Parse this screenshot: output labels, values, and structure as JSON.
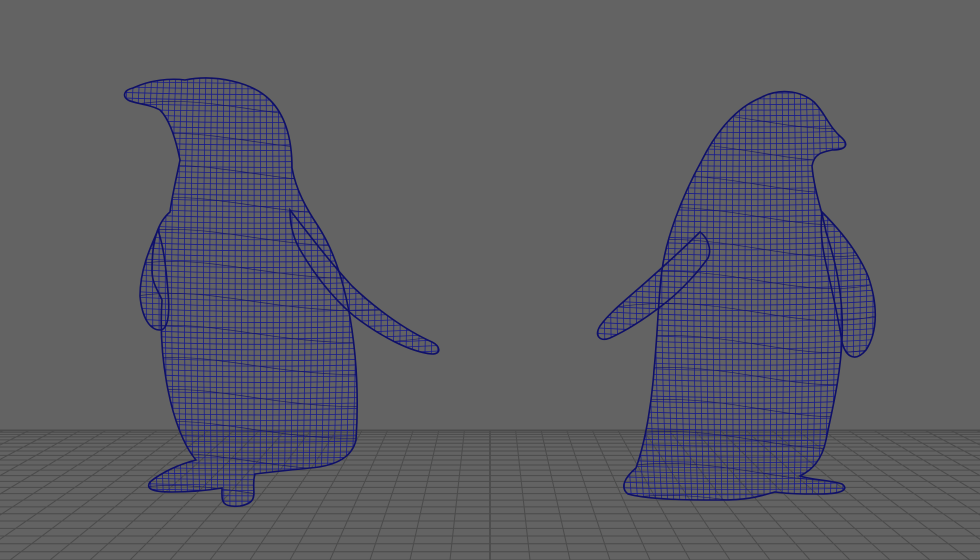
{
  "viewport": {
    "background_color": "#636363",
    "grid_color": "#4b4b4b",
    "grid_axis_color": "#3a3a3a",
    "wire_color": "#1a1d8c",
    "wire_color_dark": "#0f1068",
    "grid_visible": true
  },
  "models": [
    {
      "name": "penguin-left",
      "facing": "left",
      "display_mode": "wireframe"
    },
    {
      "name": "penguin-right",
      "facing": "right",
      "display_mode": "wireframe"
    }
  ]
}
